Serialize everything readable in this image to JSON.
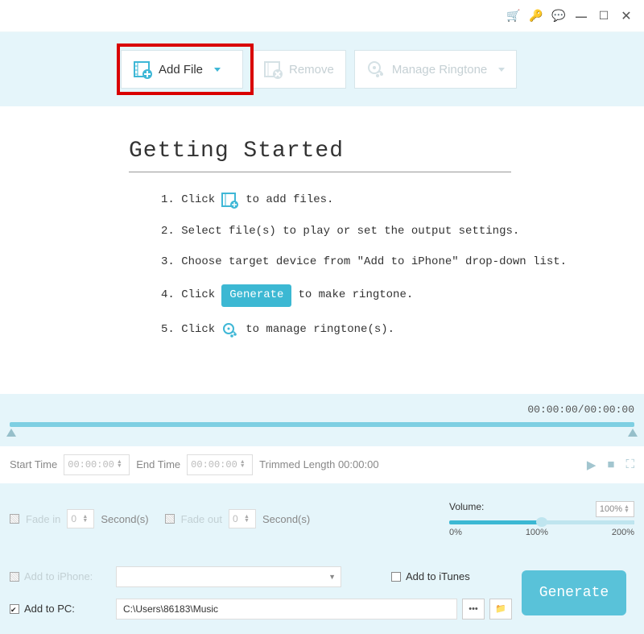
{
  "titlebar": {
    "icons": [
      "cart",
      "key",
      "comment",
      "minimize",
      "maximize",
      "close"
    ]
  },
  "toolbar": {
    "addFile": "Add File",
    "remove": "Remove",
    "manage": "Manage Ringtone"
  },
  "getting": {
    "heading": "Getting Started",
    "step1a": "1. Click",
    "step1b": "to add files.",
    "step2": "2. Select file(s) to play or set the output settings.",
    "step3": "3. Choose target device from \"Add to iPhone\" drop-down list.",
    "step4a": "4. Click",
    "step4pill": "Generate",
    "step4b": "to make ringtone.",
    "step5a": "5. Click",
    "step5b": "to manage ringtone(s)."
  },
  "timeline": {
    "readout": "00:00:00/00:00:00",
    "startLabel": "Start Time",
    "startVal": "00:00:00",
    "endLabel": "End Time",
    "endVal": "00:00:00",
    "trimmed": "Trimmed Length 00:00:00"
  },
  "fade": {
    "fadeIn": "Fade in",
    "fadeInVal": "0",
    "sec": "Second(s)",
    "fadeOut": "Fade out",
    "fadeOutVal": "0",
    "volLabel": "Volume:",
    "volPct": "100%",
    "m0": "0%",
    "m1": "100%",
    "m2": "200%"
  },
  "bottom": {
    "addIphone": "Add to iPhone:",
    "addItunes": "Add to iTunes",
    "addPc": "Add to PC:",
    "path": "C:\\Users\\86183\\Music",
    "dots": "•••",
    "generate": "Generate"
  }
}
